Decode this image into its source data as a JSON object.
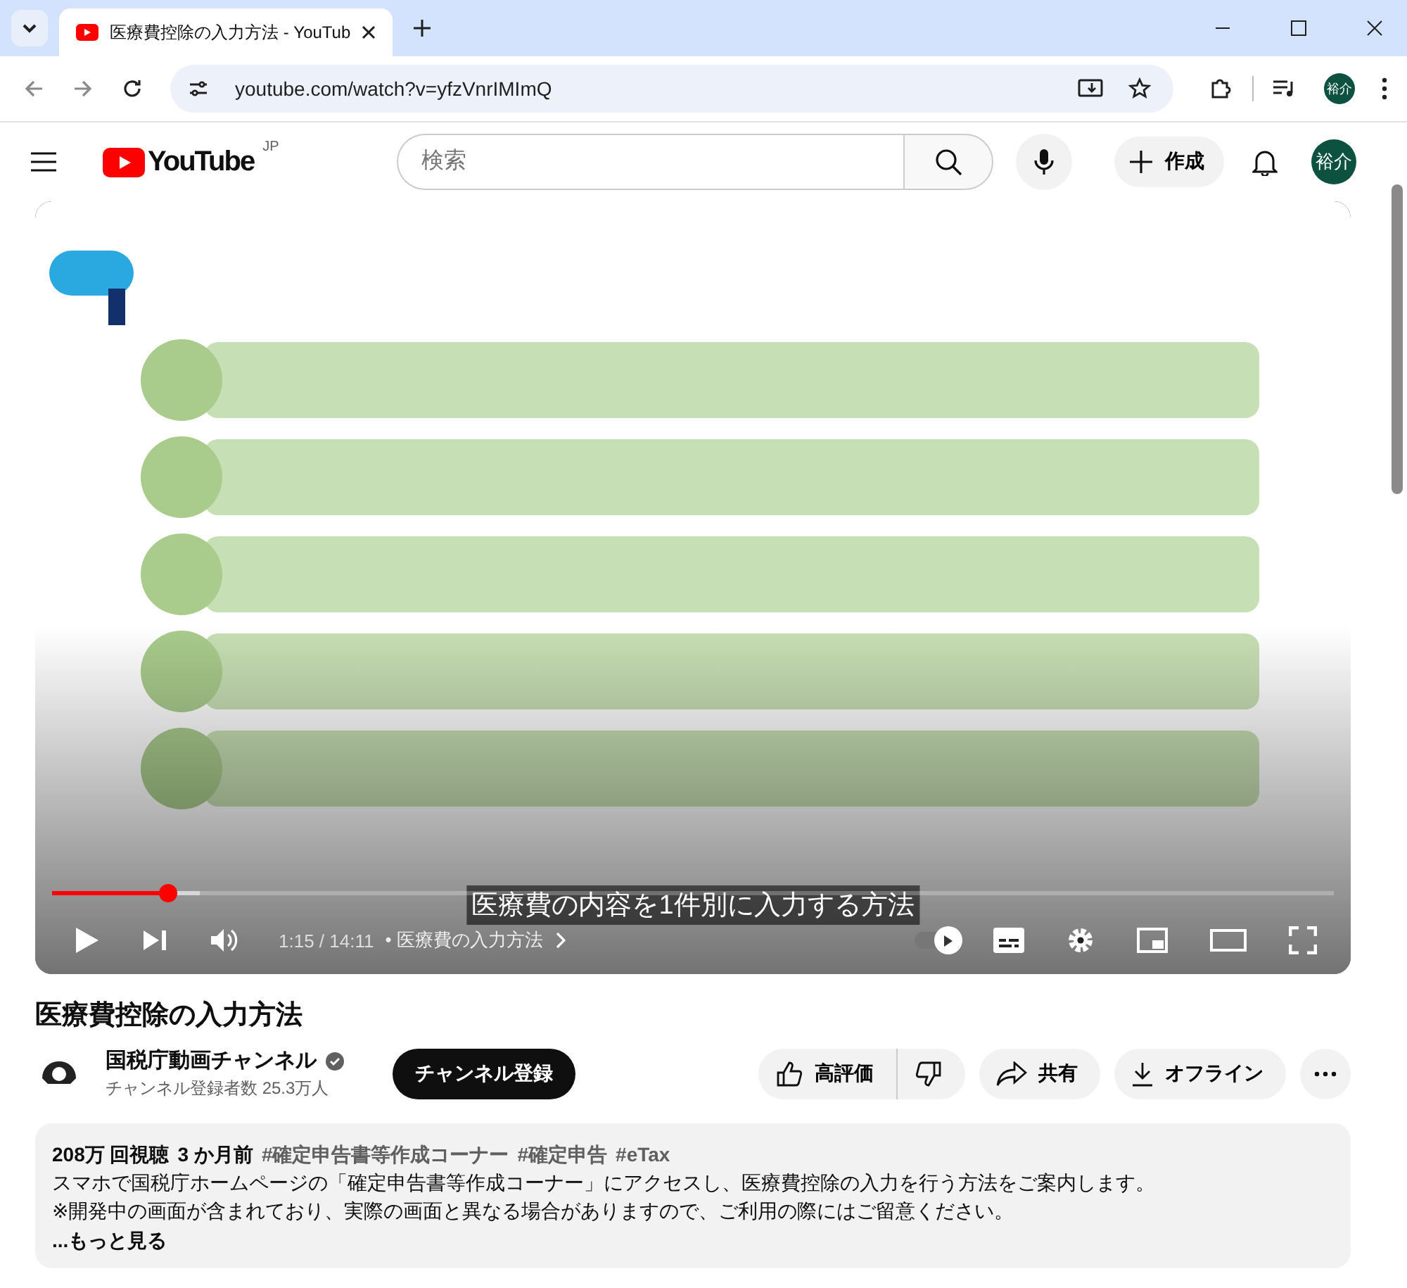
{
  "browser": {
    "tab_title": "医療費控除の入力方法 - YouTub",
    "url": "youtube.com/watch?v=yfzVnrIMImQ",
    "profile": "裕介"
  },
  "header": {
    "logo_text": "YouTube",
    "region": "JP",
    "search_placeholder": "検索",
    "create": "作成",
    "avatar": "裕介"
  },
  "player": {
    "kind": "picture",
    "caption": "医療費の内容を1件別に入力する方法",
    "playing": false,
    "progress": {
      "level": 0.09
    },
    "time": "1:15 / 14:11",
    "chapter": "• 医療費の入力方法",
    "autoplay": {
      "on": true
    }
  },
  "video": {
    "title": "医療費控除の入力方法",
    "channel": {
      "name": "国税庁動画チャンネル",
      "verified": true,
      "subscribers": "チャンネル登録者数 25.3万人"
    },
    "subscribe": "チャンネル登録",
    "like": "高評価",
    "share": "共有",
    "download": "オフライン"
  },
  "description": {
    "views": "208万 回視聴",
    "age": "3 か月前",
    "hashtags": [
      "#確定申告書等作成コーナー",
      "#確定申告",
      "#eTax"
    ],
    "lines": [
      "スマホで国税庁ホームページの「確定申告書等作成コーナー」にアクセスし、医療費控除の入力を行う方法をご案内します。",
      "※開発中の画面が含まれており、実際の画面と異なる場合がありますので、ご利用の際にはご留意ください。"
    ],
    "more": "...もっと見る"
  }
}
